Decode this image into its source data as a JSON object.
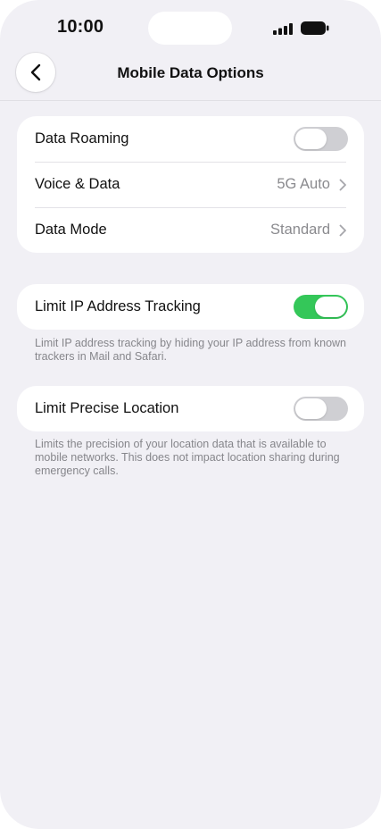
{
  "status_bar": {
    "time": "10:00",
    "icons": [
      "signal-icon",
      "battery-icon"
    ]
  },
  "nav": {
    "back_icon": "chevron-left-icon",
    "title": "Mobile Data Options"
  },
  "group_main": {
    "rows": [
      {
        "label": "Data Roaming",
        "type": "toggle",
        "enabled": false
      },
      {
        "label": "Voice & Data",
        "type": "link",
        "value": "5G Auto"
      },
      {
        "label": "Data Mode",
        "type": "link",
        "value": "Standard"
      }
    ]
  },
  "group_ip": {
    "label": "Limit IP Address Tracking",
    "enabled": true,
    "footnote": "Limit IP address tracking by hiding your IP address from known trackers in Mail and Safari."
  },
  "group_location": {
    "label": "Limit Precise Location",
    "enabled": false,
    "footnote": "Limits the precision of your location data that is available to mobile networks. This does not impact location sharing during emergency calls."
  },
  "colors": {
    "background": "#f1f0f5",
    "toggle_on": "#34c759",
    "toggle_off": "#cfcfd3",
    "secondary_text": "#8a8a8e"
  }
}
